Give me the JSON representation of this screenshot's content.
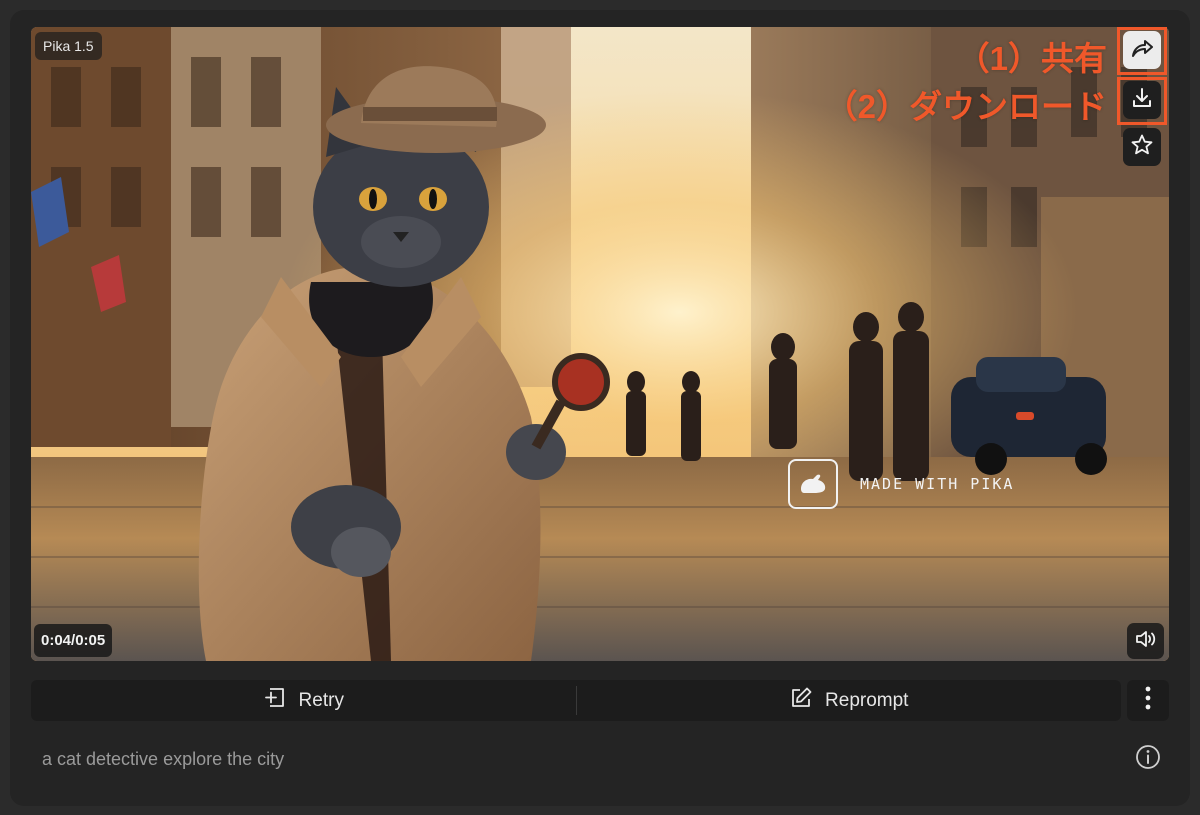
{
  "video": {
    "version_badge": "Pika 1.5",
    "timestamp": "0:04/0:05",
    "watermark_text": "MADE WITH PIKA",
    "thumbnail_subject": "cat detective in trench coat and hat holding a magnifying glass on a sunlit city street"
  },
  "side_actions": {
    "share_icon": "share-arrow-icon",
    "download_icon": "download-icon",
    "favorite_icon": "star-icon"
  },
  "annotations": {
    "share_label": "（1）共有",
    "download_label": "（2）ダウンロード",
    "highlight_color": "#f0582a"
  },
  "action_bar": {
    "retry_label": "Retry",
    "reprompt_label": "Reprompt",
    "more_icon": "vertical-ellipsis-icon"
  },
  "prompt": {
    "text": "a cat detective explore the city"
  },
  "colors": {
    "background": "#2b2b2b",
    "card": "#242424",
    "button": "#1c1c1c",
    "text": "#e6e6e6",
    "muted": "#9a9a9a",
    "accent": "#f0582a"
  }
}
